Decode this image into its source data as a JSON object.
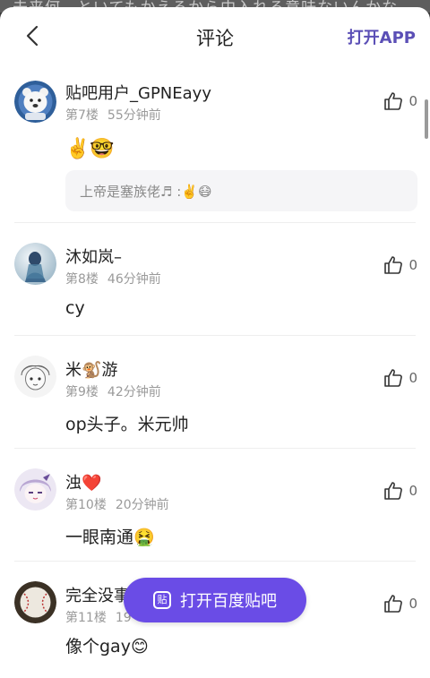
{
  "background_text": "未来何、といてもかえるから中入れる意味ないんかな",
  "header": {
    "title": "评论",
    "open_app": "打开APP"
  },
  "comments": [
    {
      "username": "贴吧用户_GPNEayy",
      "floor": "第7楼",
      "time": "55分钟前",
      "likes": "0",
      "content": "✌️🤓",
      "quote": "上帝是塞族佬♬ :✌️😷"
    },
    {
      "username": "沐如岚–",
      "floor": "第8楼",
      "time": "46分钟前",
      "likes": "0",
      "content": "cy"
    },
    {
      "username": "米🐒游",
      "floor": "第9楼",
      "time": "42分钟前",
      "likes": "0",
      "content": "op头子。米元帅"
    },
    {
      "username": "浊❤️",
      "floor": "第10楼",
      "time": "20分钟前",
      "likes": "0",
      "content": "一眼南通🤮"
    },
    {
      "username": "完全没事",
      "floor": "第11楼",
      "time": "19",
      "likes": "0",
      "content": "像个gay😊"
    }
  ],
  "float_button": {
    "icon": "贴",
    "label": "打开百度贴吧"
  },
  "colors": {
    "accent": "#6a4ce6",
    "open_app": "#5b4fb6"
  }
}
